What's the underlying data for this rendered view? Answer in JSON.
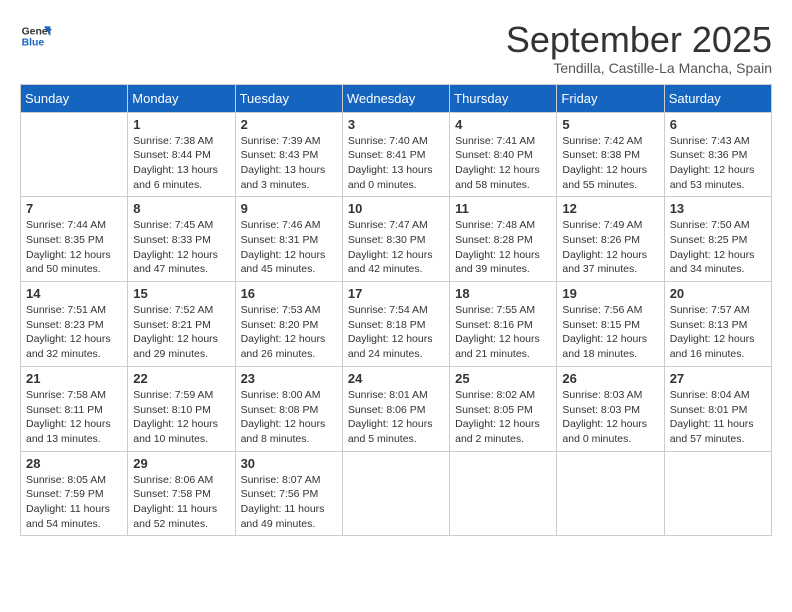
{
  "logo": {
    "text_general": "General",
    "text_blue": "Blue"
  },
  "header": {
    "title": "September 2025",
    "subtitle": "Tendilla, Castille-La Mancha, Spain"
  },
  "weekdays": [
    "Sunday",
    "Monday",
    "Tuesday",
    "Wednesday",
    "Thursday",
    "Friday",
    "Saturday"
  ],
  "weeks": [
    [
      {
        "day": "",
        "detail": ""
      },
      {
        "day": "1",
        "detail": "Sunrise: 7:38 AM\nSunset: 8:44 PM\nDaylight: 13 hours\nand 6 minutes."
      },
      {
        "day": "2",
        "detail": "Sunrise: 7:39 AM\nSunset: 8:43 PM\nDaylight: 13 hours\nand 3 minutes."
      },
      {
        "day": "3",
        "detail": "Sunrise: 7:40 AM\nSunset: 8:41 PM\nDaylight: 13 hours\nand 0 minutes."
      },
      {
        "day": "4",
        "detail": "Sunrise: 7:41 AM\nSunset: 8:40 PM\nDaylight: 12 hours\nand 58 minutes."
      },
      {
        "day": "5",
        "detail": "Sunrise: 7:42 AM\nSunset: 8:38 PM\nDaylight: 12 hours\nand 55 minutes."
      },
      {
        "day": "6",
        "detail": "Sunrise: 7:43 AM\nSunset: 8:36 PM\nDaylight: 12 hours\nand 53 minutes."
      }
    ],
    [
      {
        "day": "7",
        "detail": "Sunrise: 7:44 AM\nSunset: 8:35 PM\nDaylight: 12 hours\nand 50 minutes."
      },
      {
        "day": "8",
        "detail": "Sunrise: 7:45 AM\nSunset: 8:33 PM\nDaylight: 12 hours\nand 47 minutes."
      },
      {
        "day": "9",
        "detail": "Sunrise: 7:46 AM\nSunset: 8:31 PM\nDaylight: 12 hours\nand 45 minutes."
      },
      {
        "day": "10",
        "detail": "Sunrise: 7:47 AM\nSunset: 8:30 PM\nDaylight: 12 hours\nand 42 minutes."
      },
      {
        "day": "11",
        "detail": "Sunrise: 7:48 AM\nSunset: 8:28 PM\nDaylight: 12 hours\nand 39 minutes."
      },
      {
        "day": "12",
        "detail": "Sunrise: 7:49 AM\nSunset: 8:26 PM\nDaylight: 12 hours\nand 37 minutes."
      },
      {
        "day": "13",
        "detail": "Sunrise: 7:50 AM\nSunset: 8:25 PM\nDaylight: 12 hours\nand 34 minutes."
      }
    ],
    [
      {
        "day": "14",
        "detail": "Sunrise: 7:51 AM\nSunset: 8:23 PM\nDaylight: 12 hours\nand 32 minutes."
      },
      {
        "day": "15",
        "detail": "Sunrise: 7:52 AM\nSunset: 8:21 PM\nDaylight: 12 hours\nand 29 minutes."
      },
      {
        "day": "16",
        "detail": "Sunrise: 7:53 AM\nSunset: 8:20 PM\nDaylight: 12 hours\nand 26 minutes."
      },
      {
        "day": "17",
        "detail": "Sunrise: 7:54 AM\nSunset: 8:18 PM\nDaylight: 12 hours\nand 24 minutes."
      },
      {
        "day": "18",
        "detail": "Sunrise: 7:55 AM\nSunset: 8:16 PM\nDaylight: 12 hours\nand 21 minutes."
      },
      {
        "day": "19",
        "detail": "Sunrise: 7:56 AM\nSunset: 8:15 PM\nDaylight: 12 hours\nand 18 minutes."
      },
      {
        "day": "20",
        "detail": "Sunrise: 7:57 AM\nSunset: 8:13 PM\nDaylight: 12 hours\nand 16 minutes."
      }
    ],
    [
      {
        "day": "21",
        "detail": "Sunrise: 7:58 AM\nSunset: 8:11 PM\nDaylight: 12 hours\nand 13 minutes."
      },
      {
        "day": "22",
        "detail": "Sunrise: 7:59 AM\nSunset: 8:10 PM\nDaylight: 12 hours\nand 10 minutes."
      },
      {
        "day": "23",
        "detail": "Sunrise: 8:00 AM\nSunset: 8:08 PM\nDaylight: 12 hours\nand 8 minutes."
      },
      {
        "day": "24",
        "detail": "Sunrise: 8:01 AM\nSunset: 8:06 PM\nDaylight: 12 hours\nand 5 minutes."
      },
      {
        "day": "25",
        "detail": "Sunrise: 8:02 AM\nSunset: 8:05 PM\nDaylight: 12 hours\nand 2 minutes."
      },
      {
        "day": "26",
        "detail": "Sunrise: 8:03 AM\nSunset: 8:03 PM\nDaylight: 12 hours\nand 0 minutes."
      },
      {
        "day": "27",
        "detail": "Sunrise: 8:04 AM\nSunset: 8:01 PM\nDaylight: 11 hours\nand 57 minutes."
      }
    ],
    [
      {
        "day": "28",
        "detail": "Sunrise: 8:05 AM\nSunset: 7:59 PM\nDaylight: 11 hours\nand 54 minutes."
      },
      {
        "day": "29",
        "detail": "Sunrise: 8:06 AM\nSunset: 7:58 PM\nDaylight: 11 hours\nand 52 minutes."
      },
      {
        "day": "30",
        "detail": "Sunrise: 8:07 AM\nSunset: 7:56 PM\nDaylight: 11 hours\nand 49 minutes."
      },
      {
        "day": "",
        "detail": ""
      },
      {
        "day": "",
        "detail": ""
      },
      {
        "day": "",
        "detail": ""
      },
      {
        "day": "",
        "detail": ""
      }
    ]
  ]
}
